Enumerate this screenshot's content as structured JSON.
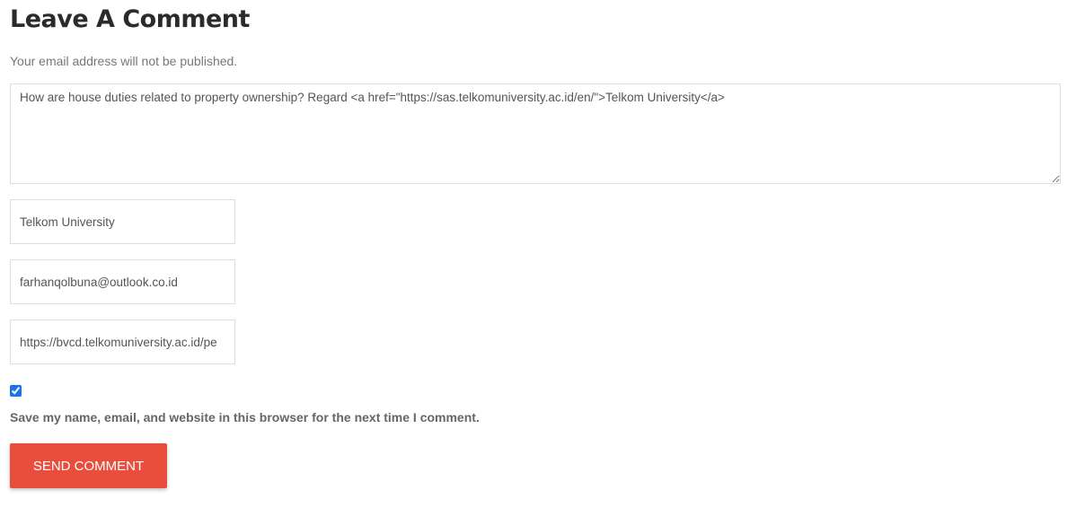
{
  "form": {
    "title": "Leave A Comment",
    "note": "Your email address will not be published.",
    "comment": {
      "value": "How are house duties related to property ownership? Regard <a href=\"https://sas.telkomuniversity.ac.id/en/\">Telkom University</a>"
    },
    "name": {
      "value": "Telkom University"
    },
    "email": {
      "value": "farhanqolbuna@outlook.co.id"
    },
    "website": {
      "value": "https://bvcd.telkomuniversity.ac.id/pe"
    },
    "consent": {
      "checked": true,
      "label": "Save my name, email, and website in this browser for the next time I comment."
    },
    "submit_label": "SEND COMMENT"
  },
  "colors": {
    "accent": "#e94e3c",
    "checkbox": "#1a73e8"
  }
}
